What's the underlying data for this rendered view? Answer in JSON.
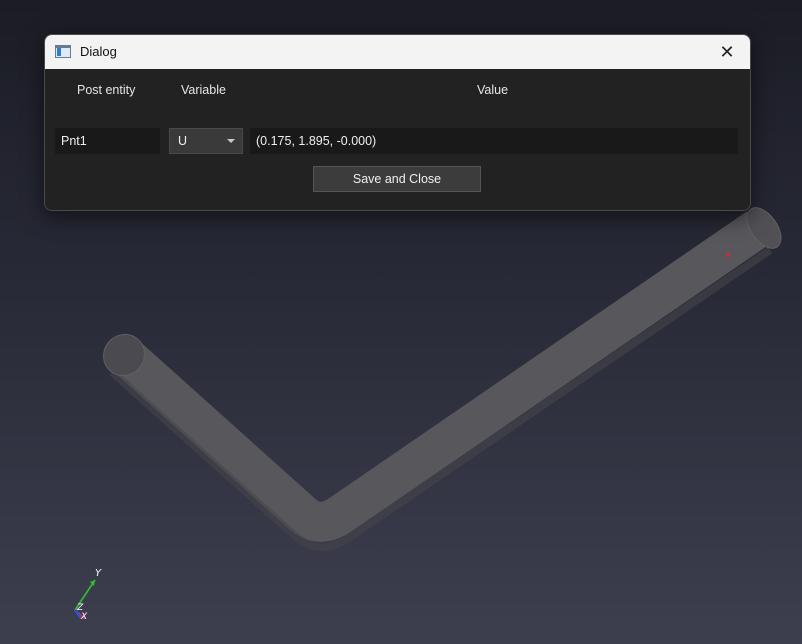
{
  "dialog": {
    "title": "Dialog",
    "close_glyph": "✕",
    "headers": {
      "post_entity": "Post entity",
      "variable": "Variable",
      "value": "Value"
    },
    "entity": "Pnt1",
    "variable": "U",
    "value": "(0.175, 1.895, -0.000)",
    "save_label": "Save and Close"
  },
  "axes": {
    "x": "X",
    "y": "Y",
    "z": "Z"
  },
  "colors": {
    "pipe": "#56565b",
    "probe_point": "#c0303a",
    "axis_x": "#e03030",
    "axis_y": "#30c030",
    "axis_z": "#3050e0"
  },
  "icons": {
    "window_icon": "app-window-icon",
    "close": "close-icon",
    "dropdown": "chevron-down-icon"
  }
}
